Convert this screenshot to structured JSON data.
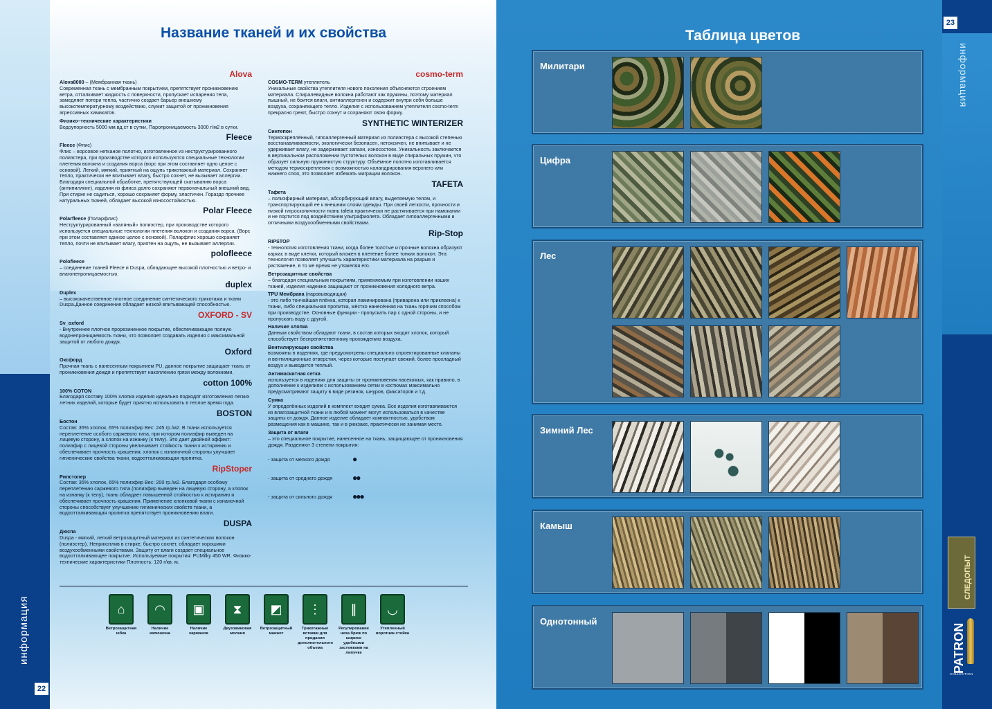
{
  "left_page": {
    "title": "Название тканей и их свойства",
    "page_number": "22",
    "side_label": "информация",
    "left_column": [
      {
        "title": "Alova8000",
        "subtitle": " – (Мембранная ткань)",
        "logo": "Alova",
        "text": "Современная ткань с мембранным покрытием, препятствует проникновению ветра, отталкивает жидкость с поверхности, пропускает испарения тела, замедляет потери тепла, частично создает барьер внешнему высокотемпературному воздействию, служит защитой от проникновения агрессивных химикатов."
      },
      {
        "title": "Физико–технические характеристики",
        "subtitle": "",
        "logo": "",
        "text": "Водоупорность 5000 мм.вд.ст в сутки, Паропроницаемость 3000 г/м2 в сутки."
      },
      {
        "title": "Fleece",
        "subtitle": " (Флис)",
        "logo": "Fleece",
        "text": "Флис – ворсовое нетканое полотно, изготовленное из неструктурированного полиэстера, при производстве которого используются специальные технологии плетения волокна и создания ворса (ворс при этом составляет одно целое с основой). Легкий, мягкий, приятный на ощупь трикотажный материал. Сохраняет тепло, практически не впитывает влагу, быстро сохнет, не вызывает аллергии. Благодаря специальной обработке, препятствующей скатыванию ворса (антипиллинг), изделия из флиса долго сохраняют первоначальный внешний вид. При стирке не садиться, хорошо сохраняет форму, эластичен. Гораздо прочнее натуральных тканей, обладает высокой износостойкостью."
      },
      {
        "title": "Polarfleece",
        "subtitle": " (Поларфлис)",
        "logo": "Polar Fleece",
        "text": "Неструктурированный «валяный» полиэстер, при производстве которого используется специальные технологии плетения волокон и создания ворса. (Ворс при этом составляет единое целое с основой). Поларфлис хорошо сохраняет тепло, почти не впитывает влагу, приятен на ощупь, не вызывает аллергии."
      },
      {
        "title": "Polofleece",
        "subtitle": "",
        "logo": "polofleece",
        "text": "– соединение тканей Fleece и Duspa, обладающее высокой плотностью и ветро- и влагонепроницаемостью."
      },
      {
        "title": "Duplex",
        "subtitle": "",
        "logo": "duplex",
        "text": "– высококачественное плотное соединение синтетического трикотажа и ткани Duspa.Данное соединение обладает низкой впитывающей способностью."
      },
      {
        "title": "Sv_oxford",
        "subtitle": "",
        "logo": "OXFORD - SV",
        "text": " - Внутреннее плотное прорезиненное покрытие, обеспечивающее полную водонепроницаемость ткани, что позволяет создавать изделия с максимальной защитой от любого дождя."
      },
      {
        "title": "Оксфорд",
        "subtitle": "",
        "logo": "Oxford",
        "text": "Прочная ткань с нанесенным покрытием PU, данное покрытие защищает ткань от проникновения дождя и препятствует накоплению грязи между волокнами."
      },
      {
        "title": "100% COTON",
        "subtitle": "",
        "logo": "cotton 100%",
        "text": "Благодаря составу 100% хлопка изделия идеально подходят изготовления легких летних изделий, которые будет приятно использовать в теплое время года."
      },
      {
        "title": "Бостон",
        "subtitle": "",
        "logo": "BOSTON",
        "text": "Состав: 35% хлопок, 65% полиэфир Вес: 245 гр./м2. В ткани используется переплетение особого саржевого типа, при котором полиэфир выведен на лицевую сторону, а хлопок на изнанку (к телу). Это дает двойной эффект: полиэфир с лицевой стороны увеличивает стойкость ткани к истиранию и обеспечивает прочность крашения; хлопок с изнаночной стороны улучшает гигиенические свойства ткани, водоотталкивающая пропитка."
      },
      {
        "title": "Рипстопер",
        "subtitle": "",
        "logo": "RipStoper",
        "text": "Состав: 35% хлопок, 65% полиэфир Вес: 200 гр./м2. Благодаря особому переплетению саржевого типа (полиэфир выведен на лицевую сторону, а хлопок на изнанку (к телу), ткань обладает повышенной стойкостью к истиранию и обеспечивает прочность крашения. Применение хлопковой ткани с изнаночной стороны способствует улучшению гигиенических свойств ткани, а водоотталкивающая пропитка препятствует проникновению влаги."
      },
      {
        "title": "Дюспа",
        "subtitle": "",
        "logo": "DUSPA",
        "text": "Duspa - мягкий, легкий ветрозащитный материал из синтетических волокон (полиэстер). Неприхотлив в стирке, быстро сохнет, обладает хорошими воздухообменными свойствами. Защиту от влаги создает специальное водоотталкивающее покрытие. Используемые покрытия: PUMilky 450 WR. Физико-технические характеристики Плотность: 120 г/кв. м."
      }
    ],
    "right_column": [
      {
        "title": "COSMO-TERM",
        "subtitle": " утеплитель",
        "logo": "cosmo-term",
        "text": "Уникальные свойства утеплителя нового поколения объясняются строением материала. Спиралевидные волокна работают как пружины, поэтому материал пышный, не боится влаги, антиаллергенен и содержит внутри себя больше воздуха, сохраняющего тепло. Изделия с использованием утеплителя cosmo-term прекрасно греют, быстро сохнут и сохраняют свою форму."
      },
      {
        "title": "Синтепон",
        "subtitle": "",
        "logo": "SYNTHETIC WINTERIZER",
        "text": "Термоскреплённый, гипоаллергенный материал из полиэстера с высокой степенью восстанавливаемости, экологически безопасен, нетоксичен, не впитывает и не удерживает влагу, не задерживает запахи, износостоек. Уникальность заключается в вертикальном расположении пустотелых волокон в виде спиральных пружин, что образует сильную пружинистую структуру. Объёмное полотно изготавливается методом термоскрепления с возможностью каландрирования верхнего или нижнего слоя, это позволяет избежать миграции волокон."
      },
      {
        "title": "Тафета",
        "subtitle": "",
        "logo": "TAFETA",
        "text": "– полиэфирный материал, абсорбирующий влагу, выделяемую телом, и транспортирующий ее к внешним слоям одежды. При своей легкости, прочности и низкой гигроскопичности ткань tafeta практически не растягивается при намокании и не портится под воздействием ультрафиолета. Обладает гипоаллергенными и отличными воздухообменными свойствами."
      },
      {
        "title": "RIPSTOP",
        "subtitle": "",
        "logo": "Rip-Stop",
        "text": "- технология изготовления ткани, когда более толстые и прочные волокна образуют каркас в виде клетки, который вложен в плетение более тонких волокон. Эта технология позволяет улучшить характеристики материала на разрыв и растяжение, в то же время не утяжеляя его."
      },
      {
        "title": "Ветрозащитные свойства",
        "subtitle": "",
        "logo": "",
        "text": "– благодаря специальным покрытиям, применяемым при изготовлении наших тканей, изделия надежно защищают от проникновения холодного ветра."
      },
      {
        "title": "TPU Мембрана",
        "subtitle": " (паровыводящая)",
        "logo": "",
        "text": " - это либо тончайшая плёнка, которая ламинирована (приварена или приклеена) к ткани, либо специальная пропитка, жёстко нанесённая на ткань горячим способом при производстве. Основные функции - пропускать пар с одной стороны, и не пропускать воду с другой."
      },
      {
        "title": "Наличие хлопка",
        "subtitle": "",
        "logo": "",
        "text": "Данным свойством обладают ткани, в состав которых входит хлопок, который способствует беспрепятственному прохождению воздуха."
      },
      {
        "title": "Вентилирующие свойства",
        "subtitle": "",
        "logo": "",
        "text": "возможны в изделиях, где предусмотрены специально спроектированные клапаны и вентиляционные отверстия, через которые поступает свежий, более прохладный воздух и выводится теплый."
      },
      {
        "title": "Антимаскитная сетка",
        "subtitle": "",
        "logo": "",
        "text": "используется в изделиях для защиты от проникновения насекомых, как правило, в дополнение к изделиям с использованием сетки в костюмах максимально предусматривают защиту в виде резинок, шнуров, фиксаторов и т.д."
      },
      {
        "title": "Сумка",
        "subtitle": "",
        "logo": "",
        "text": "У определённых изделий в комплект входит сумка. Все изделия изготавливаются из влагозащитной ткани и в любой момент могут использоваться в качестве защиты от дождя. Данное изделие обладает компактностью, удобством размещения как в машине, так и в рюкзаке, практически не занимая место."
      },
      {
        "title": "Защита от влаги",
        "subtitle": "",
        "logo": "",
        "text": "– это специальное покрытие, нанесенное на ткань, защищающее от проникновения дождя. Разделяют 3 степени покрытия:"
      }
    ],
    "rain_levels": [
      "- защита от мелкого дождя",
      "- защита от среднего дождя",
      "- защита от сильного дождя"
    ],
    "features": [
      {
        "label": "Ветрозащитная юбка",
        "icon": "windproof-skirt-icon"
      },
      {
        "label": "Наличие капюшона",
        "icon": "hood-icon"
      },
      {
        "label": "Наличие карманов",
        "icon": "pockets-icon"
      },
      {
        "label": "Двухзамковая молния",
        "icon": "double-zipper-icon"
      },
      {
        "label": "Ветрозащитный манжет",
        "icon": "windproof-cuff-icon"
      },
      {
        "label": "Трикотажные вставки для придания дополнительного объема",
        "icon": "knit-inserts-icon"
      },
      {
        "label": "Регулирование низа брюк по ширине удобными застежками на липучке",
        "icon": "trouser-adjust-icon"
      },
      {
        "label": "Утепленный воротник-стойка",
        "icon": "warm-collar-icon"
      }
    ]
  },
  "right_page": {
    "title": "Таблица цветов",
    "page_number": "23",
    "side_label": "информация",
    "brand": "PATRON",
    "brand_sub": "COLLECTION",
    "badge": "СЛЕДОПЫТ",
    "categories": [
      {
        "name": "Милитари",
        "swatches": [
          {
            "bg": "repeating-radial-gradient(circle at 20% 30%,#3f5a2b 0 10px,#7a6a3a 10px 18px,#1e2a16 18px 24px,#9aa07a 24px 30px)"
          },
          {
            "bg": "repeating-radial-gradient(circle at 70% 40%,#6b6a36 0 8px,#2b3a1e 8px 15px,#b59a62 15px 22px,#4f5d30 22px 28px)"
          }
        ]
      },
      {
        "name": "Цифра",
        "swatches": [
          {
            "bg": "repeating-linear-gradient(45deg,#6d7b5b 0 6px,#9ea585 6px 12px,#4e5b41 12px 18px,#b6b89c 18px 24px)"
          },
          {
            "bg": "repeating-linear-gradient(45deg,#9ca09a 0 6px,#c5c7bf 6px 12px,#7e837d 12px 18px,#b1b4ab 18px 24px)"
          },
          {
            "bg": "repeating-linear-gradient(45deg,#2d4124 0 7px,#d9762a 7px 14px,#1a2a15 14px 20px,#5e7d3a 20px 27px)"
          }
        ]
      },
      {
        "name": "Лес",
        "swatches": [
          {
            "bg": "repeating-linear-gradient(120deg,#3d3a2c 0 5px,#8a8463 5px 12px,#5b5a3c 12px 17px,#c0b99a 17px 22px)"
          },
          {
            "bg": "repeating-linear-gradient(60deg,#4a4634 0 6px,#9a926e 6px 12px,#2e2c20 12px 16px,#b5ad8b 16px 22px)"
          },
          {
            "bg": "repeating-linear-gradient(150deg,#4a3b22 0 6px,#8c7446 6px 13px,#2c2414 13px 17px,#a89460 17px 23px)"
          },
          {
            "bg": "repeating-linear-gradient(100deg,#b56a3e 0 6px,#e2b08a 6px 12px,#8a4e2a 12px 17px,#d99c70 17px 23px)"
          },
          {
            "bg": "repeating-linear-gradient(30deg,#5a5548 0 7px,#b3ab94 7px 13px,#3a362c 13px 18px,#8e6b46 18px 24px)"
          },
          {
            "bg": "repeating-linear-gradient(80deg,#4d4a41 0 6px,#a9a18c 6px 12px,#34312a 12px 16px,#c6bfa8 16px 22px)"
          },
          {
            "bg": "repeating-linear-gradient(140deg,#7c7666 0 6px,#c4bda8 6px 13px,#5a5446 13px 17px,#a89478 17px 23px)"
          }
        ]
      },
      {
        "name": "Зимний Лес",
        "swatches": [
          {
            "bg": "repeating-linear-gradient(110deg,#2c2a25 0 4px,#ddd9cf 4px 12px,#6e6a60 12px 15px,#f2efe8 15px 22px)"
          },
          {
            "bg": "radial-gradient(circle at 40% 45%,#2f5a55 0 6px,transparent 7px),radial-gradient(circle at 60% 70%,#2f5a55 0 7px,transparent 8px),radial-gradient(circle at 55% 50%,#2f5a55 0 5px,transparent 6px),linear-gradient(#eef2f0,#dfe6e4)"
          },
          {
            "bg": "repeating-linear-gradient(130deg,#e6e0d6 0 8px,#b7aa9c 8px 12px,#f4f0ea 12px 20px,#8f8276 20px 23px)"
          }
        ]
      },
      {
        "name": "Камыш",
        "swatches": [
          {
            "bg": "repeating-linear-gradient(75deg,#5c4d32 0 3px,#b19a6a 3px 7px,#7a6a44 7px 10px,#d2bb88 10px 14px)"
          },
          {
            "bg": "repeating-linear-gradient(70deg,#4c4a35 0 3px,#9e9570 3px 7px,#6c6848 7px 10px,#c2b992 10px 14px)"
          },
          {
            "bg": "repeating-linear-gradient(80deg,#5a4a32 0 3px,#a88f62 3px 7px,#3f3322 7px 10px,#c7ae7e 10px 14px)"
          }
        ]
      },
      {
        "name": "Однотонный",
        "swatches": [
          {
            "bg": "#9ea4a8"
          },
          {
            "bg": "linear-gradient(90deg,#767b80 0 50%,#3e4448 50% 100%)"
          },
          {
            "bg": "linear-gradient(90deg,#ffffff 0 50%,#000000 50% 100%)"
          },
          {
            "bg": "linear-gradient(90deg,#9c8a72 0 50%,#5a4436 50% 100%)"
          }
        ]
      }
    ]
  }
}
